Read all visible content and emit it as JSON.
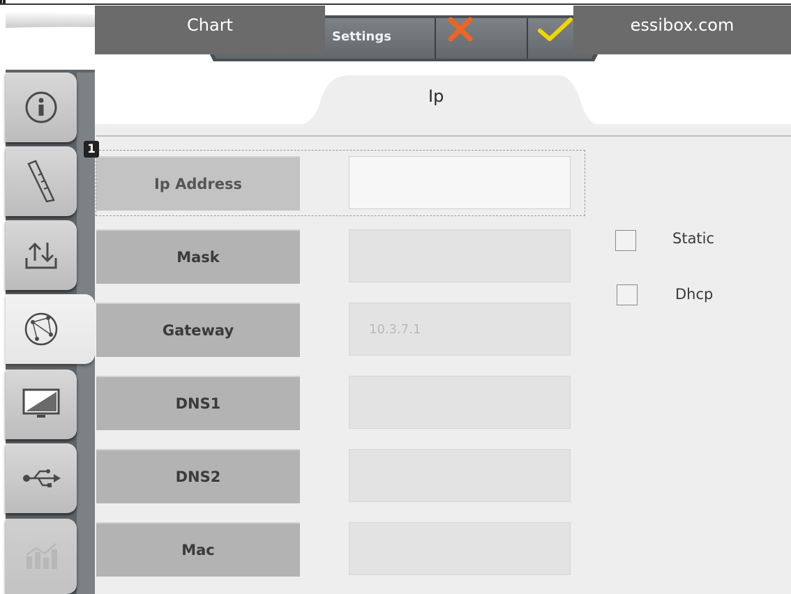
{
  "toolbar": {
    "settings_label": "Settings",
    "settings_icon": "sliders-icon",
    "cancel_icon": "close-icon",
    "confirm_icon": "check-icon",
    "cancel_color": "#f06420",
    "confirm_color": "#f2d600"
  },
  "tabs": [
    {
      "label": "Chart"
    },
    {
      "label": "Ip",
      "active": true
    },
    {
      "label": "essibox.com"
    }
  ],
  "sidebar": {
    "items": [
      {
        "icon": "info-icon"
      },
      {
        "icon": "ruler-icon"
      },
      {
        "icon": "upload-download-icon"
      },
      {
        "icon": "network-globe-icon",
        "active": true
      },
      {
        "icon": "display-icon"
      },
      {
        "icon": "usb-icon"
      },
      {
        "icon": "chart-icon",
        "disabled": true
      }
    ]
  },
  "fields": [
    {
      "label": "Ip Address",
      "value": ""
    },
    {
      "label": "Mask",
      "value": ""
    },
    {
      "label": "Gateway",
      "value": "10.3.7.1"
    },
    {
      "label": "DNS1",
      "value": ""
    },
    {
      "label": "DNS2",
      "value": ""
    },
    {
      "label": "Mac",
      "value": ""
    }
  ],
  "focus_badge": "1",
  "options": [
    {
      "label": "Static",
      "checked": false
    },
    {
      "label": "Dhcp",
      "checked": false
    }
  ]
}
